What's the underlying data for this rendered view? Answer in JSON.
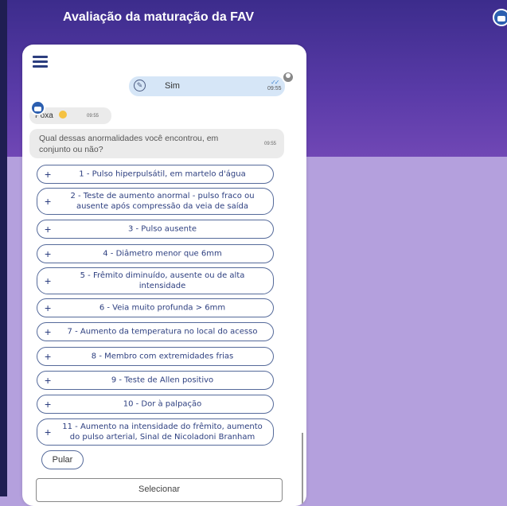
{
  "header": {
    "title": "Avaliação da maturação da FAV"
  },
  "chat": {
    "user_message": {
      "text": "Sim",
      "time": "09:55"
    },
    "bot_message_1": {
      "text": "Poxa",
      "emoji": "sad-face",
      "time": "09:55"
    },
    "bot_message_2": {
      "text": "Qual dessas anormalidades você encontrou, em conjunto ou não?",
      "time": "09:55"
    }
  },
  "options": [
    "1 - Pulso hiperpulsátil, em martelo d'água",
    "2 - Teste de aumento anormal - pulso fraco ou ausente após compressão da veia de saída",
    "3 - Pulso ausente",
    "4 - Diâmetro menor que 6mm",
    "5 - Frêmito diminuído, ausente ou de alta intensidade",
    "6 - Veia muito profunda > 6mm",
    "7 - Aumento da temperatura no local do acesso",
    "8 - Membro com extremidades frias",
    "9 - Teste de Allen positivo",
    "10 - Dor à palpação",
    "11 - Aumento na intensidade do frêmito, aumento do pulso arterial, Sinal de Nicoladoni Branham"
  ],
  "plus_glyph": "+",
  "skip_label": "Pular",
  "select_label": "Selecionar",
  "colors": {
    "accent": "#2c3e7f",
    "header_bg": "#5a3ba8",
    "page_bg": "#b4a0dd"
  }
}
